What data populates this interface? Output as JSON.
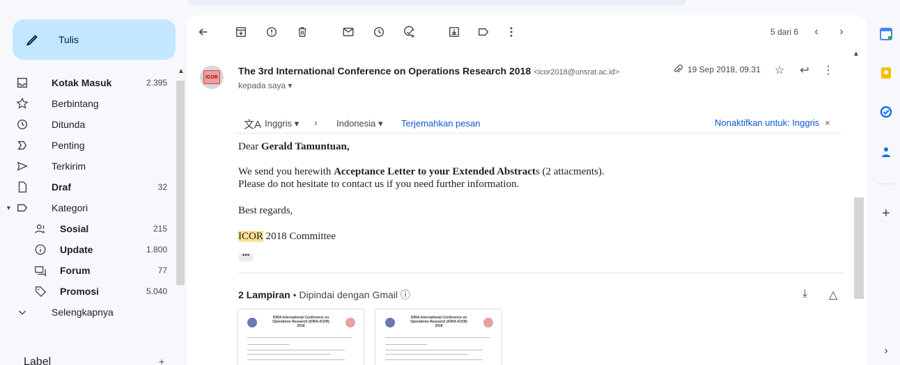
{
  "compose": {
    "label": "Tulis"
  },
  "nav": [
    {
      "label": "Kotak Masuk",
      "count": "2.395",
      "bold": true,
      "icon": "inbox-icon"
    },
    {
      "label": "Berbintang",
      "count": "",
      "bold": false,
      "icon": "star-icon"
    },
    {
      "label": "Ditunda",
      "count": "",
      "bold": false,
      "icon": "clock-icon"
    },
    {
      "label": "Penting",
      "count": "",
      "bold": false,
      "icon": "important-icon"
    },
    {
      "label": "Terkirim",
      "count": "",
      "bold": false,
      "icon": "send-icon"
    },
    {
      "label": "Draf",
      "count": "32",
      "bold": true,
      "icon": "draft-icon"
    },
    {
      "label": "Kategori",
      "count": "",
      "bold": false,
      "icon": "label-icon"
    },
    {
      "label": "Sosial",
      "count": "215",
      "bold": true,
      "icon": "people-icon"
    },
    {
      "label": "Update",
      "count": "1.800",
      "bold": true,
      "icon": "info-icon"
    },
    {
      "label": "Forum",
      "count": "77",
      "bold": true,
      "icon": "forum-icon"
    },
    {
      "label": "Promosi",
      "count": "5.040",
      "bold": true,
      "icon": "tag-icon"
    },
    {
      "label": "Selengkapnya",
      "count": "",
      "bold": false,
      "icon": "chevron-down-icon"
    }
  ],
  "labels_header": "Label",
  "labels_add": "+",
  "toolbar": {
    "pager": "5 dari 6"
  },
  "email": {
    "subject": "The 3rd International Conference on Operations Research 2018",
    "sender_email": "<icor2018@unsrat.ac.id>",
    "to": "kepada saya ▾",
    "date": "19 Sep 2018, 09.31",
    "avatar_text": "ICOR"
  },
  "translate": {
    "source": "Inggris ▾",
    "target": "Indonesia ▾",
    "link": "Terjemahkan pesan",
    "disable": "Nonaktifkan untuk: Inggris",
    "close": "×"
  },
  "body": {
    "greeting_prefix": "Dear ",
    "greeting_name": "Gerald Tamuntuan,",
    "line1_prefix": "We send you herewith ",
    "line1_bold": "Acceptance Letter to your Extended Abstract",
    "line1_suffix": "s (2 attacments).",
    "line2": "Please do not hesitate to contact us if you need further information.",
    "regards": "Best regards,",
    "sig_hl": "ICOR",
    "sig_rest": " 2018 Committee",
    "ellipsis": "•••"
  },
  "attachments": {
    "count_label": "2 Lampiran",
    "scanned": " • Dipindai dengan Gmail ⓘ",
    "thumb_title": "IORA-International Conference on Operations Research (IORA-ICOR) 2018"
  }
}
